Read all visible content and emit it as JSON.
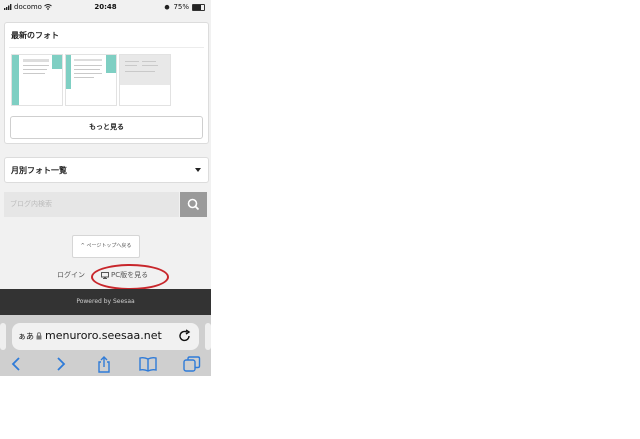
{
  "status_bar": {
    "carrier": "docomo",
    "time": "20:48",
    "battery": "75%",
    "battery_level": 0.75
  },
  "latest_photos": {
    "title": "最新のフォト",
    "more_label": "もっと見る"
  },
  "monthly": {
    "label": "月別フォト一覧"
  },
  "search": {
    "placeholder": "ブログ内検索"
  },
  "page_top": {
    "label": "ページトップへ戻る"
  },
  "footer_links": {
    "login": "ログイン",
    "pc_view": "PC版を見る"
  },
  "footer": {
    "powered_by": "Powered by Seesaa"
  },
  "browser": {
    "aa_label": "ぁあ",
    "url": "menuroro.seesaa.net"
  },
  "colors": {
    "annotation_circle": "#c8262b",
    "toolbar_icon": "#2f7bd8",
    "footer_bg": "#333333"
  }
}
